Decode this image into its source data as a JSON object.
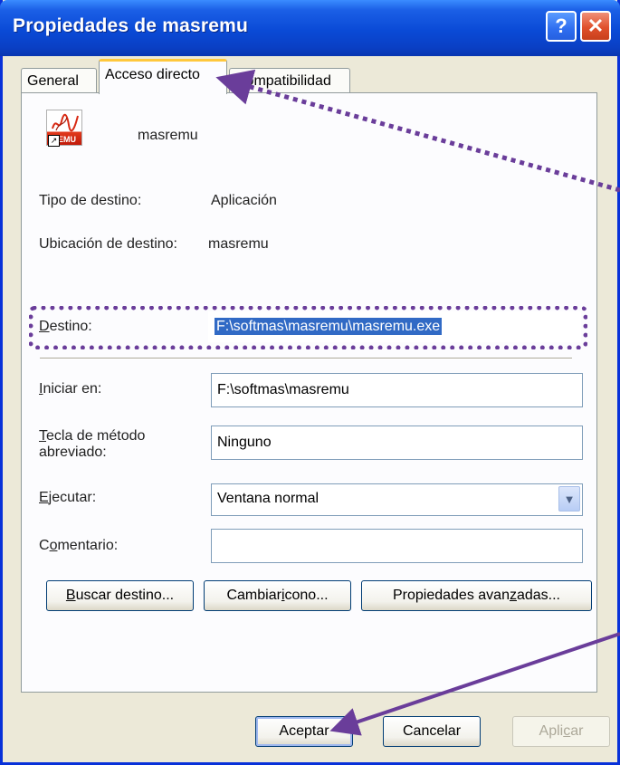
{
  "window": {
    "title": "Propiedades de masremu",
    "help_label": "?",
    "close_label": "✕"
  },
  "tabs": [
    {
      "label": "General"
    },
    {
      "label": "Acceso directo",
      "active": true
    },
    {
      "label": "Compatibilidad"
    }
  ],
  "shortcut": {
    "name": "masremu",
    "icon": "masremu-app-icon",
    "icon_text": "EMU",
    "target_type_label": "Tipo de destino:",
    "target_type_value": "Aplicación",
    "target_location_label": "Ubicación de destino:",
    "target_location_value": "masremu",
    "target_label_first": "D",
    "target_label_rest": "estino:",
    "target_value": "F:\\softmas\\masremu\\masremu.exe",
    "start_in_label_first": "I",
    "start_in_label_rest": "niciar en:",
    "start_in_value": "F:\\softmas\\masremu",
    "hotkey_label_first": "T",
    "hotkey_label_rest": "ecla de método",
    "hotkey_label_line2": "abreviado:",
    "hotkey_value": "Ninguno",
    "run_label_first": "E",
    "run_label_rest": "jecutar:",
    "run_value": "Ventana normal",
    "comment_label_pre": "C",
    "comment_label_u": "o",
    "comment_label_rest": "mentario:",
    "comment_value": ""
  },
  "buttons": {
    "find_target_u": "B",
    "find_target_rest": "uscar destino...",
    "change_icon_pre": "Cambiar ",
    "change_icon_u": "i",
    "change_icon_rest": "cono...",
    "advanced_pre": "Propiedades avan",
    "advanced_u": "z",
    "advanced_rest": "adas...",
    "ok": "Aceptar",
    "cancel": "Cancelar",
    "apply_pre": "Apli",
    "apply_u": "c",
    "apply_rest": "ar"
  },
  "annotation_color": "#6a3d9a"
}
